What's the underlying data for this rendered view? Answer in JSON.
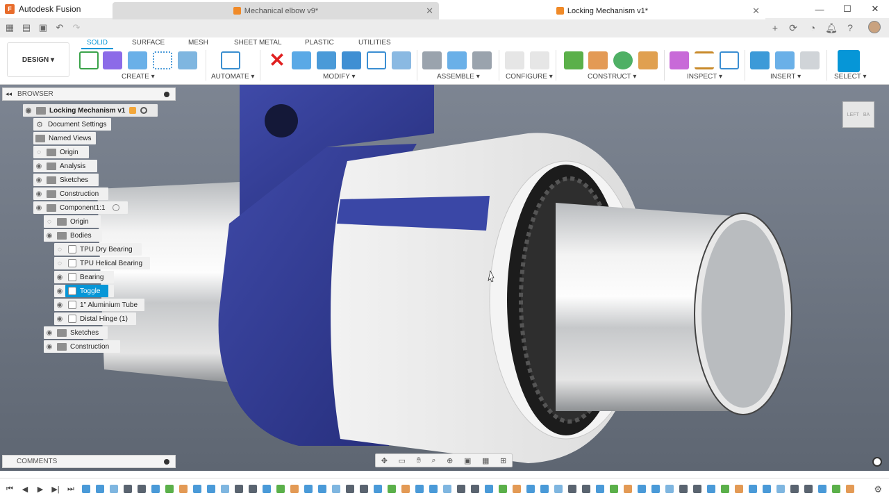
{
  "app": {
    "title": "Autodesk Fusion",
    "logo_letter": "F",
    "accent": "#0696d7"
  },
  "window_controls": {
    "minimize": "—",
    "maximize": "☐",
    "close": "✕"
  },
  "tabs": [
    {
      "label": "Mechanical elbow v9*",
      "active": false
    },
    {
      "label": "Locking Mechanism v1*",
      "active": true
    }
  ],
  "toolbar": {
    "workspace": "DESIGN",
    "workspace_tabs": [
      "SOLID",
      "SURFACE",
      "MESH",
      "SHEET METAL",
      "PLASTIC",
      "UTILITIES"
    ],
    "groups": [
      "CREATE",
      "AUTOMATE",
      "MODIFY",
      "ASSEMBLE",
      "CONFIGURE",
      "CONSTRUCT",
      "INSPECT",
      "INSERT",
      "SELECT"
    ]
  },
  "browser": {
    "title": "BROWSER",
    "root": "Locking Mechanism v1",
    "items": [
      {
        "label": "Document Settings",
        "icon": "gear-icon"
      },
      {
        "label": "Named Views",
        "icon": "folder-icon"
      },
      {
        "label": "Origin",
        "icon": "folder-icon"
      },
      {
        "label": "Analysis",
        "icon": "folder-icon"
      },
      {
        "label": "Sketches",
        "icon": "folder-icon"
      },
      {
        "label": "Construction",
        "icon": "folder-icon"
      },
      {
        "label": "Component1:1",
        "icon": "component-icon"
      },
      {
        "label": "Origin",
        "icon": "folder-icon"
      },
      {
        "label": "Bodies",
        "icon": "folder-icon"
      },
      {
        "label": "TPU Dry Bearing",
        "icon": "body-icon"
      },
      {
        "label": "TPU Helical Bearing",
        "icon": "body-icon"
      },
      {
        "label": "Bearing",
        "icon": "body-icon"
      },
      {
        "label": "Toggle",
        "icon": "body-icon",
        "selected": true
      },
      {
        "label": "1\" Aluminium Tube",
        "icon": "body-icon"
      },
      {
        "label": "Distal Hinge (1)",
        "icon": "body-icon"
      },
      {
        "label": "Sketches",
        "icon": "folder-icon"
      },
      {
        "label": "Construction",
        "icon": "folder-icon"
      }
    ]
  },
  "comments": {
    "title": "COMMENTS"
  },
  "viewcube": {
    "left": "LEFT",
    "right": "BA"
  }
}
